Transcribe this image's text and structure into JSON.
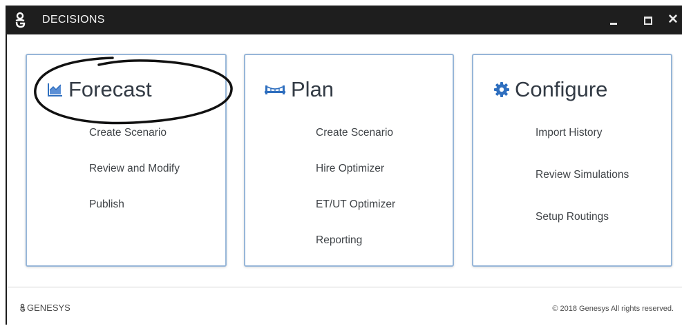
{
  "window": {
    "title": "DECISIONS",
    "logo_icon": "genesys-g-icon",
    "controls": [
      "minimize-icon",
      "maximize-icon",
      "close-icon"
    ]
  },
  "cards": {
    "forecast": {
      "icon": "area-chart-icon",
      "title": "Forecast",
      "items": [
        "Create Scenario",
        "Review and Modify",
        "Publish"
      ]
    },
    "plan": {
      "icon": "bridge-icon",
      "title": "Plan",
      "items": [
        "Create Scenario",
        "Hire Optimizer",
        "ET/UT Optimizer",
        "Reporting"
      ]
    },
    "configure": {
      "icon": "gear-icon",
      "title": "Configure",
      "items": [
        "Import History",
        "Review Simulations",
        "Setup Routings"
      ]
    }
  },
  "footer": {
    "brand": "GENESYS",
    "copyright": "© 2018 Genesys All rights reserved."
  },
  "colors": {
    "titlebar": "#1e1e1e",
    "card_border": "#97b6d8",
    "icon_blue": "#2f6fbf",
    "text": "#3f4347"
  }
}
